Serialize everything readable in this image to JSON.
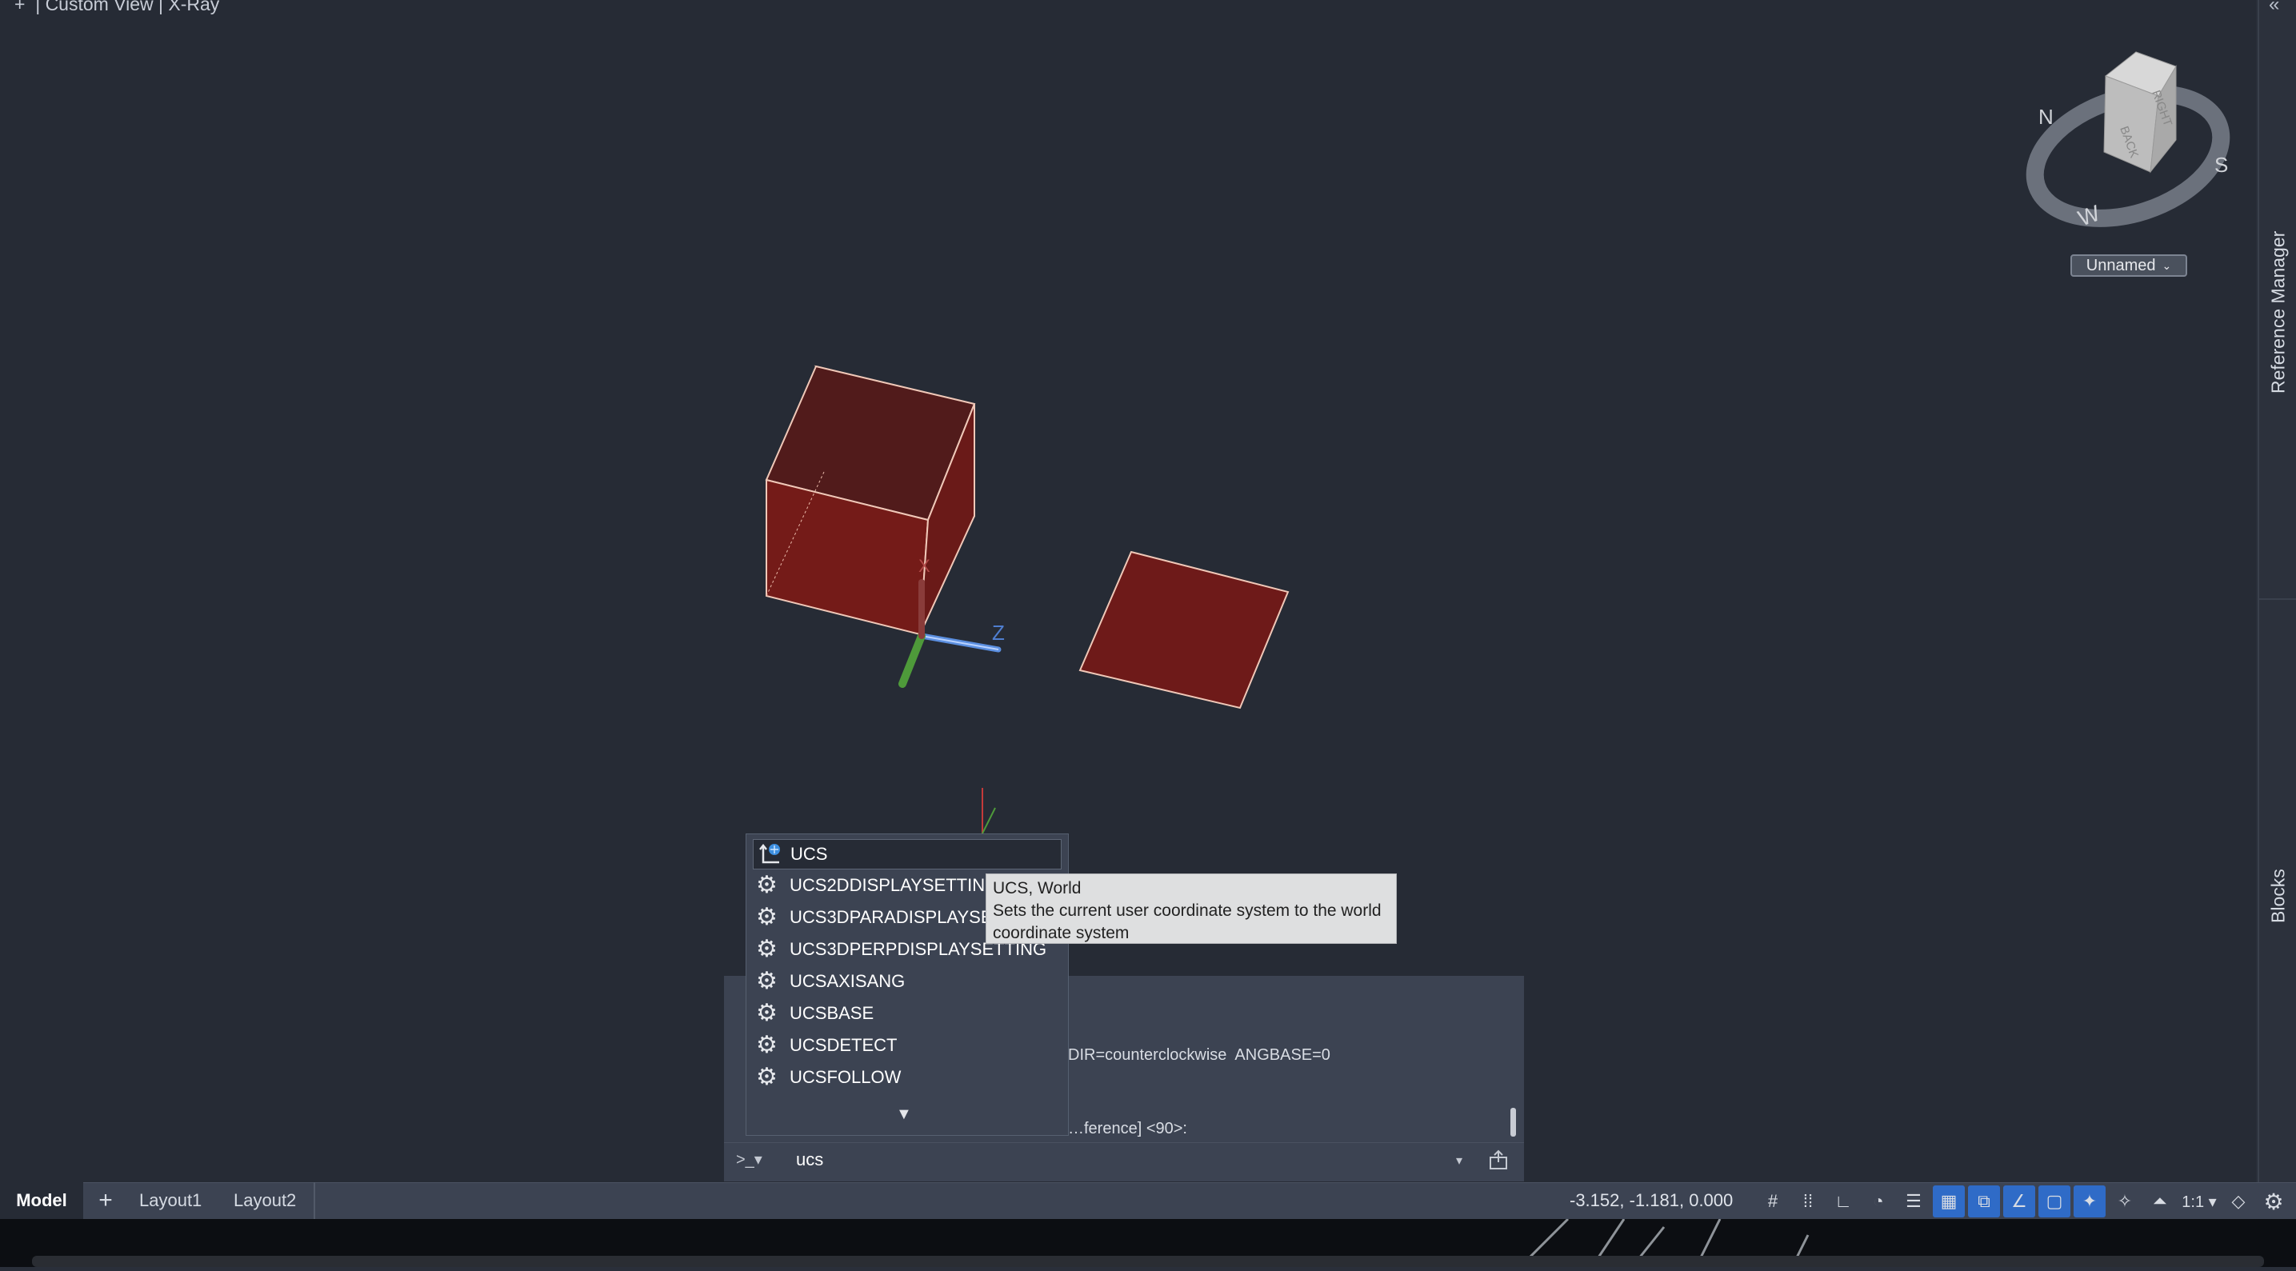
{
  "viewport": {
    "label": "+  | Custom View | X-Ray",
    "axis_z": "Z",
    "axis_x": "X"
  },
  "viewcube": {
    "faces": {
      "right": "RIGHT",
      "back": "BACK"
    },
    "compass": {
      "n": "N",
      "s": "S",
      "w": "W"
    },
    "view_name": "Unnamed"
  },
  "sidebar": {
    "collapse": "«",
    "tabs": [
      "Reference Manager",
      "Blocks"
    ]
  },
  "command_history": {
    "lines": [
      "DIR=counterclockwise  ANGBASE=0",
      "…ference] <90>:"
    ]
  },
  "command_line": {
    "prompt_icon": ">_▾",
    "input_value": "ucs",
    "dropdown": "▾"
  },
  "autocomplete": {
    "items": [
      {
        "label": "UCS",
        "icon": "ucs-icon"
      },
      {
        "label": "UCS2DDISPLAYSETTING",
        "icon": "gear-icon"
      },
      {
        "label": "UCS3DPARADISPLAYSETTING",
        "icon": "gear-icon"
      },
      {
        "label": "UCS3DPERPDISPLAYSETTING",
        "icon": "gear-icon"
      },
      {
        "label": "UCSAXISANG",
        "icon": "gear-icon"
      },
      {
        "label": "UCSBASE",
        "icon": "gear-icon"
      },
      {
        "label": "UCSDETECT",
        "icon": "gear-icon"
      },
      {
        "label": "UCSFOLLOW",
        "icon": "gear-icon"
      }
    ],
    "more": "▼"
  },
  "tooltip": {
    "title": "UCS, World",
    "body": "Sets the current user coordinate system to the world coordinate system"
  },
  "layout_tabs": {
    "model": "Model",
    "add": "+",
    "layout1": "Layout1",
    "layout2": "Layout2"
  },
  "status": {
    "coordinates": "-3.152,  -1.181, 0.000",
    "scale": "1:1 ▾",
    "icons": [
      "grid-icon",
      "snap-icon",
      "ortho-icon",
      "polar-icon",
      "lineweight-icon",
      "transparency-icon",
      "selection-cycling-icon",
      "osnap-icon",
      "dynucs-icon",
      "annotation-visibility-icon",
      "autoscale-icon",
      "annotation-scale-icon",
      "workspace-icon",
      "settings-gear-icon"
    ]
  },
  "colors": {
    "viewport_bg": "#262b35",
    "solid_fill": "#7a1c1a",
    "edge": "#f0c8b8",
    "accent_blue": "#2f6bc7"
  }
}
